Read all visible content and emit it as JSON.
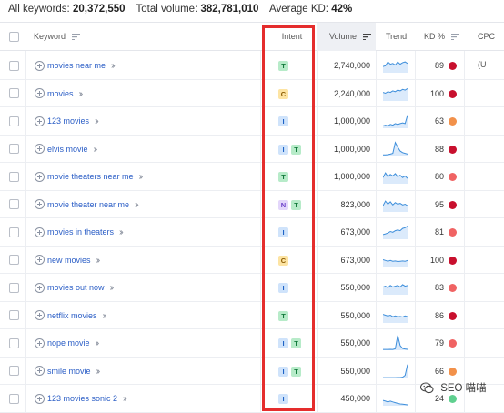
{
  "summary": {
    "all_keywords_label": "All keywords:",
    "all_keywords_value": "20,372,550",
    "total_volume_label": "Total volume:",
    "total_volume_value": "382,781,010",
    "average_kd_label": "Average KD:",
    "average_kd_value": "42%"
  },
  "columns": {
    "keyword": "Keyword",
    "intent": "Intent",
    "volume": "Volume",
    "trend": "Trend",
    "kd": "KD %",
    "cpc": "CPC (U"
  },
  "intent_colors": {
    "T": {
      "bg": "#b7ebc9",
      "fg": "#137a3c"
    },
    "C": {
      "bg": "#fde4a3",
      "fg": "#8a5a00"
    },
    "I": {
      "bg": "#cfe3fb",
      "fg": "#1e63c6"
    },
    "N": {
      "bg": "#e3d6fb",
      "fg": "#6b3fc9"
    }
  },
  "kd_colors": {
    "very_hard": "#c8102e",
    "hard": "#f06363",
    "difficult": "#f2914a",
    "easy": "#5fd08f"
  },
  "rows": [
    {
      "keyword": "movies near me",
      "intent": [
        "T"
      ],
      "volume": "2,740,000",
      "kd": "89",
      "kd_level": "very_hard",
      "trend": [
        0.4,
        0.45,
        0.7,
        0.55,
        0.6,
        0.5,
        0.7,
        0.55,
        0.65,
        0.7,
        0.6
      ]
    },
    {
      "keyword": "movies",
      "intent": [
        "C"
      ],
      "volume": "2,240,000",
      "kd": "100",
      "kd_level": "very_hard",
      "trend": [
        0.55,
        0.5,
        0.6,
        0.55,
        0.65,
        0.6,
        0.7,
        0.65,
        0.75,
        0.7,
        0.8
      ]
    },
    {
      "keyword": "123 movies",
      "intent": [
        "I"
      ],
      "volume": "1,000,000",
      "kd": "63",
      "kd_level": "difficult",
      "trend": [
        0.15,
        0.2,
        0.15,
        0.25,
        0.2,
        0.3,
        0.25,
        0.3,
        0.35,
        0.3,
        0.85
      ]
    },
    {
      "keyword": "elvis movie",
      "intent": [
        "I",
        "T"
      ],
      "volume": "1,000,000",
      "kd": "88",
      "kd_level": "very_hard",
      "trend": [
        0.1,
        0.1,
        0.12,
        0.15,
        0.2,
        0.9,
        0.6,
        0.35,
        0.25,
        0.2,
        0.15
      ]
    },
    {
      "keyword": "movie theaters near me",
      "intent": [
        "T"
      ],
      "volume": "1,000,000",
      "kd": "80",
      "kd_level": "hard",
      "trend": [
        0.4,
        0.7,
        0.45,
        0.6,
        0.5,
        0.65,
        0.45,
        0.55,
        0.4,
        0.5,
        0.35
      ]
    },
    {
      "keyword": "movie theater near me",
      "intent": [
        "N",
        "T"
      ],
      "volume": "823,000",
      "kd": "95",
      "kd_level": "very_hard",
      "trend": [
        0.4,
        0.7,
        0.5,
        0.65,
        0.45,
        0.6,
        0.5,
        0.55,
        0.45,
        0.5,
        0.4
      ]
    },
    {
      "keyword": "movies in theaters",
      "intent": [
        "I"
      ],
      "volume": "673,000",
      "kd": "81",
      "kd_level": "hard",
      "trend": [
        0.3,
        0.35,
        0.4,
        0.5,
        0.45,
        0.55,
        0.6,
        0.55,
        0.7,
        0.75,
        0.85
      ]
    },
    {
      "keyword": "new movies",
      "intent": [
        "C"
      ],
      "volume": "673,000",
      "kd": "100",
      "kd_level": "very_hard",
      "trend": [
        0.5,
        0.45,
        0.4,
        0.45,
        0.4,
        0.42,
        0.38,
        0.4,
        0.42,
        0.4,
        0.45
      ]
    },
    {
      "keyword": "movies out now",
      "intent": [
        "I"
      ],
      "volume": "550,000",
      "kd": "83",
      "kd_level": "hard",
      "trend": [
        0.5,
        0.55,
        0.45,
        0.6,
        0.5,
        0.55,
        0.6,
        0.5,
        0.65,
        0.55,
        0.6
      ]
    },
    {
      "keyword": "netflix movies",
      "intent": [
        "T"
      ],
      "volume": "550,000",
      "kd": "86",
      "kd_level": "very_hard",
      "trend": [
        0.55,
        0.5,
        0.45,
        0.5,
        0.4,
        0.45,
        0.4,
        0.42,
        0.38,
        0.45,
        0.4
      ]
    },
    {
      "keyword": "nope movie",
      "intent": [
        "I",
        "T"
      ],
      "volume": "550,000",
      "kd": "79",
      "kd_level": "hard",
      "trend": [
        0.05,
        0.05,
        0.05,
        0.06,
        0.05,
        0.1,
        0.95,
        0.3,
        0.12,
        0.08,
        0.06
      ]
    },
    {
      "keyword": "smile movie",
      "intent": [
        "I",
        "T"
      ],
      "volume": "550,000",
      "kd": "66",
      "kd_level": "difficult",
      "trend": [
        0.05,
        0.05,
        0.05,
        0.05,
        0.05,
        0.05,
        0.06,
        0.06,
        0.08,
        0.2,
        0.9
      ]
    },
    {
      "keyword": "123 movies sonic 2",
      "intent": [
        "I"
      ],
      "volume": "450,000",
      "kd": "24",
      "kd_level": "easy",
      "trend": [
        0.35,
        0.3,
        0.25,
        0.3,
        0.25,
        0.2,
        0.15,
        0.12,
        0.1,
        0.08,
        0.06
      ]
    }
  ],
  "watermark": {
    "text": "SEO 喵喵",
    "icon": "wechat-icon"
  }
}
